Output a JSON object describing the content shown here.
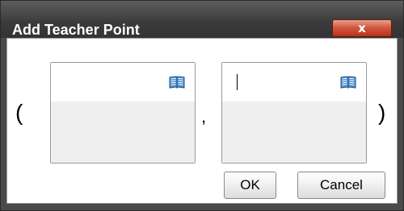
{
  "window": {
    "title": "Add Teacher Point",
    "close_label": "x"
  },
  "point": {
    "open_paren": "(",
    "separator": ",",
    "close_paren": ")",
    "x_value": "",
    "y_value": ""
  },
  "icons": {
    "catalog": "book-icon"
  },
  "buttons": {
    "ok": "OK",
    "cancel": "Cancel"
  },
  "colors": {
    "titlebar": "#3c3c3c",
    "close_button": "#c8442a"
  }
}
